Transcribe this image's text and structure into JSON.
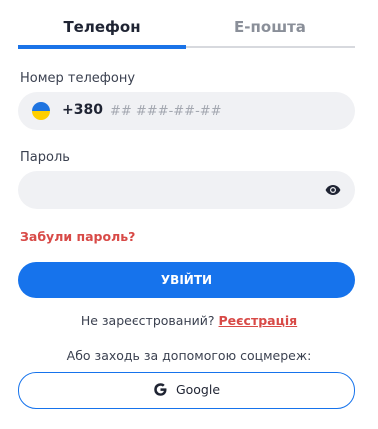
{
  "tabs": {
    "phone": "Телефон",
    "email": "E-пошта",
    "active": "phone"
  },
  "phone": {
    "label": "Номер телефону",
    "country_code": "+380",
    "placeholder": "## ###-##-##",
    "value": ""
  },
  "password": {
    "label": "Пароль",
    "value": ""
  },
  "forgot_password": "Забули пароль?",
  "login_button": "УВІЙТИ",
  "register": {
    "prompt": "Не зареєстрований?",
    "link": "Реєстрація"
  },
  "social": {
    "caption": "Або заходь за допомогою соцмереж:",
    "google_label": "Google"
  },
  "icons": {
    "flag": "ukraine-flag-icon",
    "eye": "eye-icon",
    "google": "google-g-icon"
  },
  "colors": {
    "accent": "#1673ec",
    "link_red": "#d84a47",
    "field_bg": "#f0f1f4"
  }
}
